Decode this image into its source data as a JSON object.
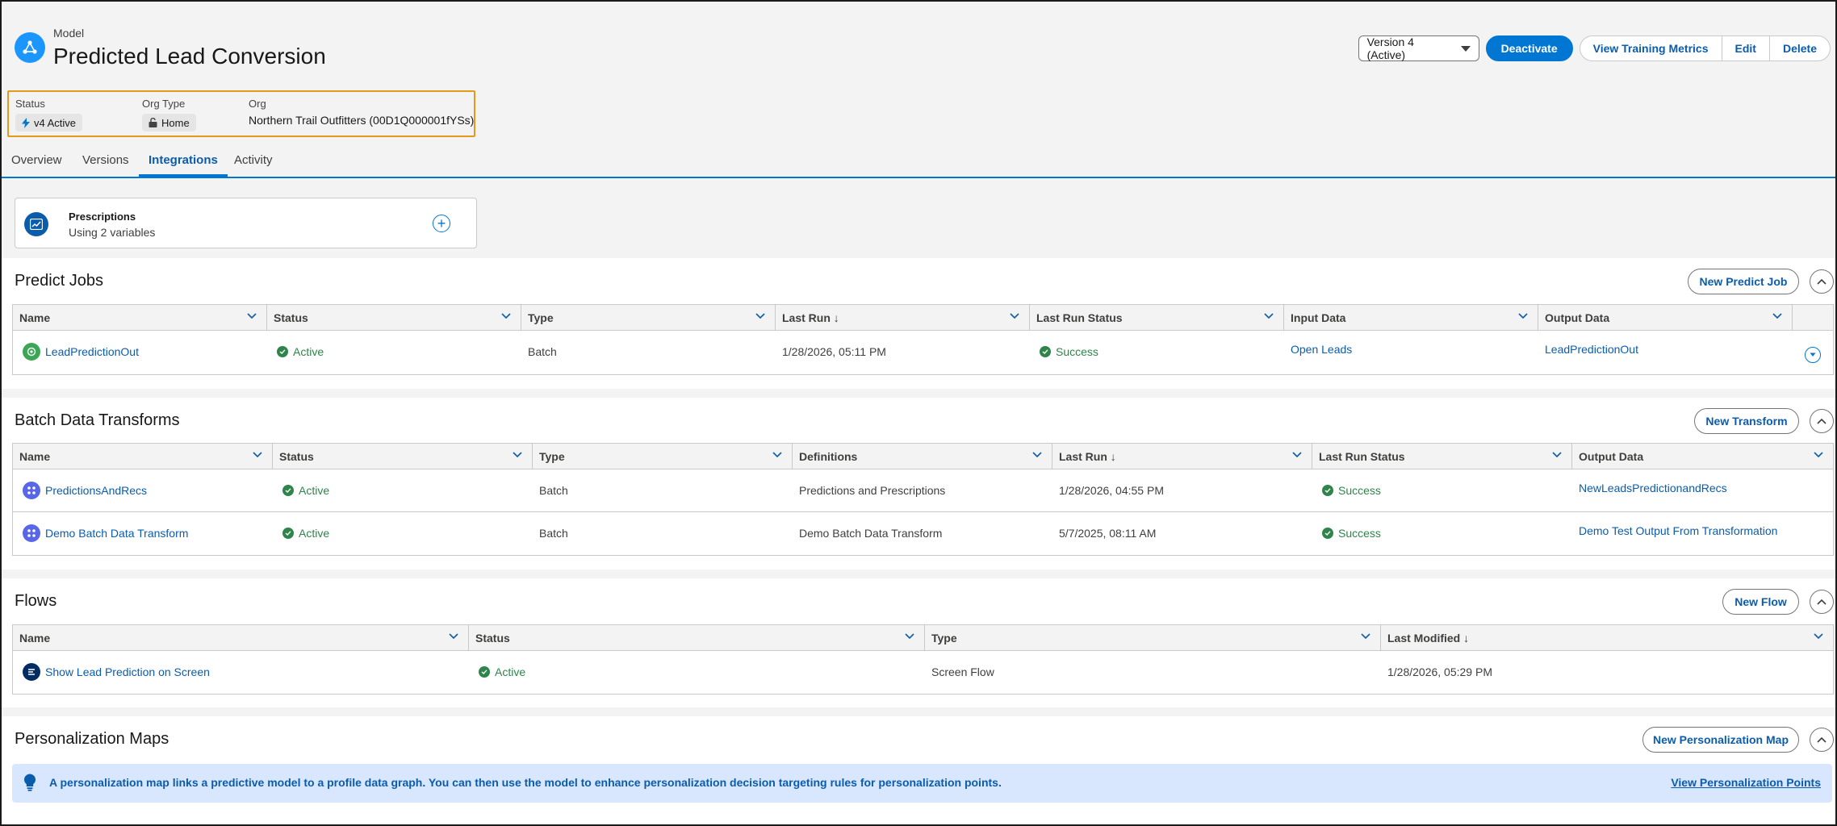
{
  "header": {
    "object_label": "Model",
    "title": "Predicted Lead Conversion",
    "version_select": "Version 4 (Active)",
    "actions": {
      "deactivate": "Deactivate",
      "view_training_metrics": "View Training Metrics",
      "edit": "Edit",
      "delete": "Delete"
    },
    "fields": {
      "status_label": "Status",
      "status_value": "v4 Active",
      "org_type_label": "Org Type",
      "org_type_value": "Home",
      "org_label": "Org",
      "org_value": "Northern Trail Outfitters (00D1Q000001fYSs)"
    },
    "tabs": [
      "Overview",
      "Versions",
      "Integrations",
      "Activity"
    ],
    "active_tab": "Integrations"
  },
  "prescriptions": {
    "title": "Prescriptions",
    "subtitle": "Using 2 variables"
  },
  "predict_jobs": {
    "title": "Predict Jobs",
    "new_button": "New Predict Job",
    "columns": [
      "Name",
      "Status",
      "Type",
      "Last Run ↓",
      "Last Run Status",
      "Input Data",
      "Output Data"
    ],
    "rows": [
      {
        "name": "LeadPredictionOut",
        "status": "Active",
        "type": "Batch",
        "last_run": "1/28/2026, 05:11 PM",
        "last_run_status": "Success",
        "input_data": "Open Leads",
        "output_data": "LeadPredictionOut"
      }
    ]
  },
  "batch_transforms": {
    "title": "Batch Data Transforms",
    "new_button": "New Transform",
    "columns": [
      "Name",
      "Status",
      "Type",
      "Definitions",
      "Last Run ↓",
      "Last Run Status",
      "Output Data"
    ],
    "rows": [
      {
        "name": "PredictionsAndRecs",
        "status": "Active",
        "type": "Batch",
        "definitions": "Predictions and Prescriptions",
        "last_run": "1/28/2026, 04:55 PM",
        "last_run_status": "Success",
        "output_data": "NewLeadsPredictionandRecs"
      },
      {
        "name": "Demo Batch Data Transform",
        "status": "Active",
        "type": "Batch",
        "definitions": "Demo Batch Data Transform",
        "last_run": "5/7/2025, 08:11 AM",
        "last_run_status": "Success",
        "output_data": "Demo Test Output From Transformation"
      }
    ]
  },
  "flows": {
    "title": "Flows",
    "new_button": "New Flow",
    "columns": [
      "Name",
      "Status",
      "Type",
      "Last Modified ↓"
    ],
    "rows": [
      {
        "name": "Show Lead Prediction on Screen",
        "status": "Active",
        "type": "Screen Flow",
        "last_modified": "1/28/2026, 05:29 PM"
      }
    ]
  },
  "personalization": {
    "title": "Personalization Maps",
    "new_button": "New Personalization Map",
    "info_text": "A personalization map links a predictive model to a profile data graph. You can then use the model to enhance personalization decision targeting rules for personalization points.",
    "info_link": "View Personalization Points"
  },
  "colors": {
    "brand": "#0176d3",
    "link": "#0b5cab",
    "success": "#2e844a",
    "highlight_border": "#e39a1a",
    "info_bg": "#d8e6fe"
  }
}
